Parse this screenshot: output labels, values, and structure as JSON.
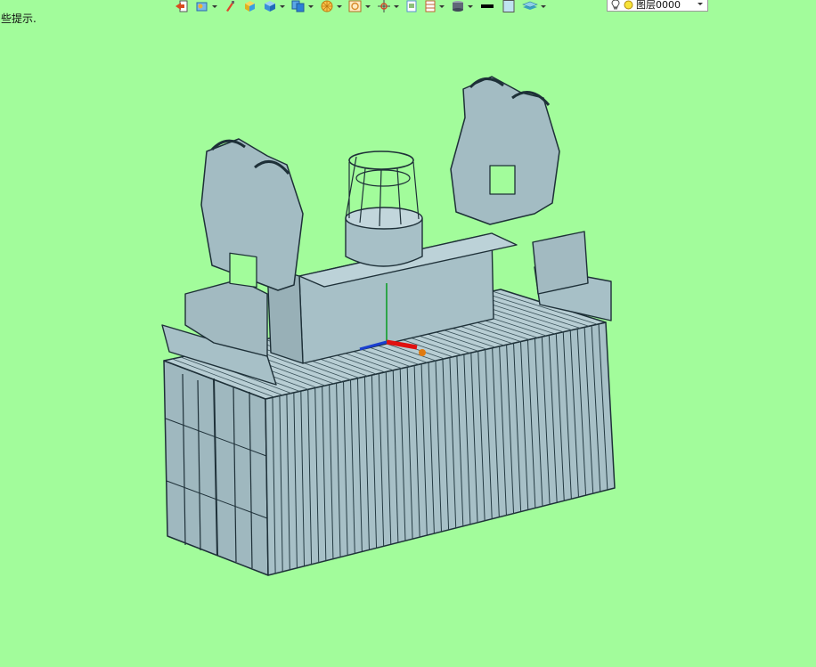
{
  "hint": {
    "text": "些提示."
  },
  "toolbar": {
    "buttons": [
      {
        "name": "exit-icon",
        "color": "#d94b1f"
      },
      {
        "name": "tools-icon",
        "color": "#3a8fd8"
      },
      {
        "name": "brush-icon",
        "color": "#e0462a"
      },
      {
        "name": "cube-yellow-icon",
        "color": "#f0c020"
      },
      {
        "name": "cube-blue-icon",
        "color": "#2c7fd6"
      },
      {
        "name": "copy-icon",
        "color": "#2c7fd6"
      },
      {
        "name": "color-wheel-icon",
        "color": "#f0a020"
      },
      {
        "name": "image-icon",
        "color": "#d88a2a"
      },
      {
        "name": "snap-icon",
        "color": "#d64a2a"
      },
      {
        "name": "page-icon",
        "color": "#5a8fd0"
      },
      {
        "name": "frame-icon",
        "color": "#c06030"
      },
      {
        "name": "cylinder-icon",
        "color": "#606878"
      },
      {
        "name": "line-weight-icon",
        "color": "#000000"
      },
      {
        "name": "fill-color-icon",
        "color": "#bfe3f0"
      },
      {
        "name": "layers-icon",
        "color": "#3aa0c0"
      }
    ],
    "layer": {
      "label": "图层0000"
    }
  },
  "model": {
    "fill": "#a7c0c7",
    "stroke": "#1e3038"
  }
}
